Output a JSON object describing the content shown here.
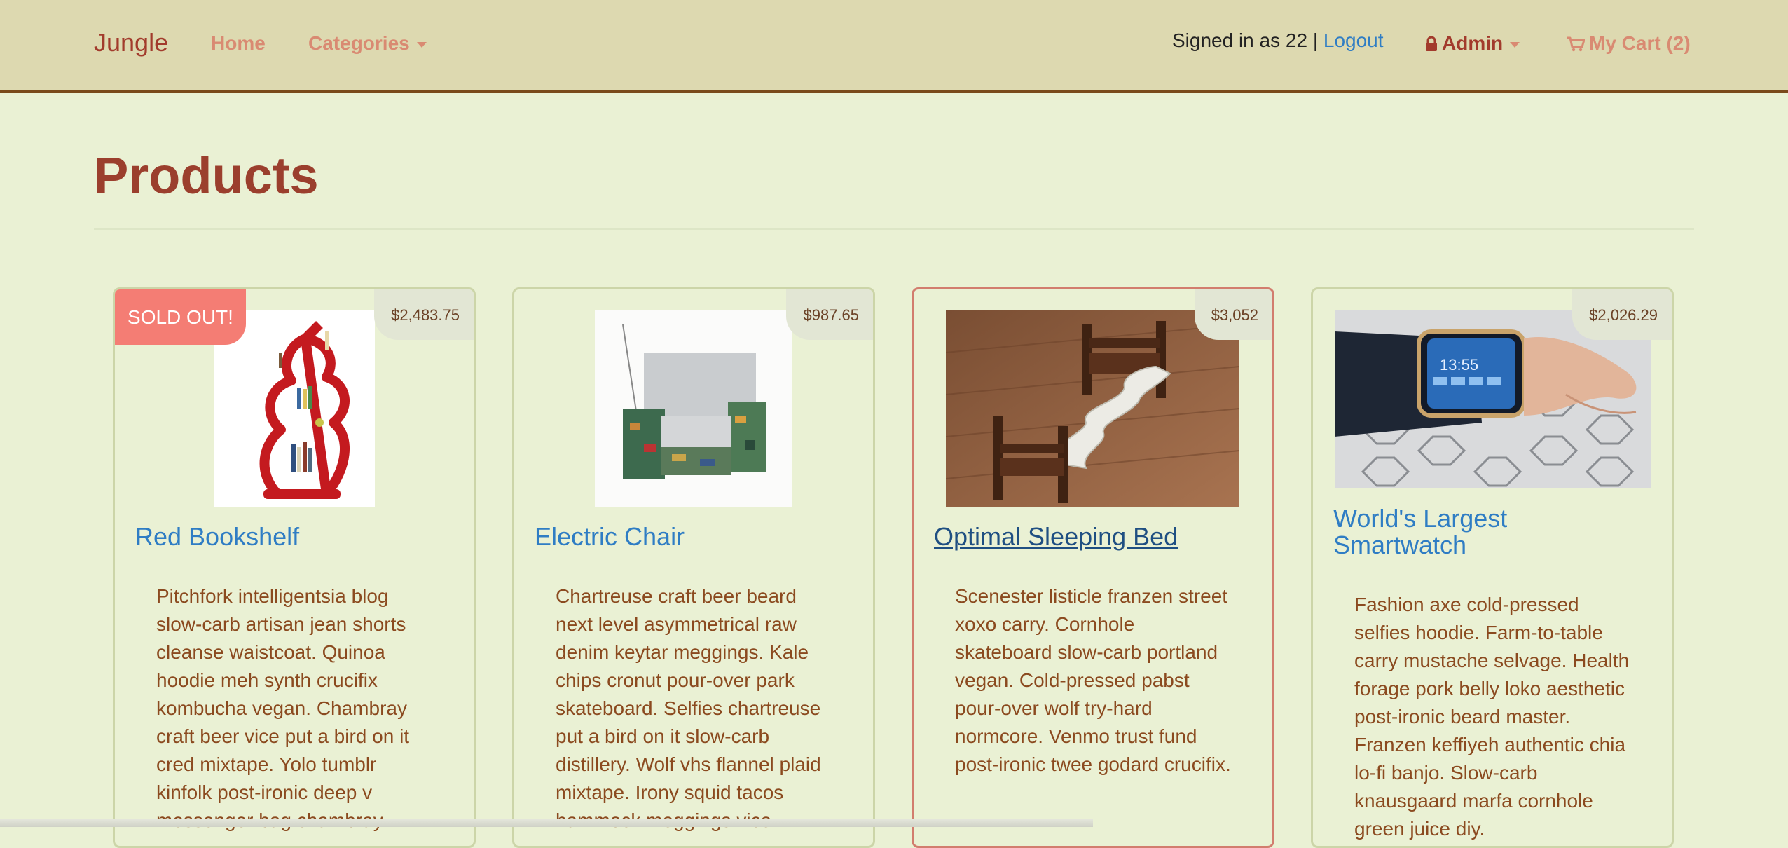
{
  "navbar": {
    "brand": "Jungle",
    "home_label": "Home",
    "categories_label": "Categories",
    "signed_in_text": "Signed in as 22",
    "separator": "|",
    "logout_label": "Logout",
    "admin_label": "Admin",
    "cart_label": "My Cart (2)"
  },
  "page": {
    "title": "Products"
  },
  "products": [
    {
      "name": "Red Bookshelf",
      "price": "$2,483.75",
      "sold_out_label": "SOLD OUT!",
      "description": "Pitchfork intelligentsia blog slow-carb artisan jean shorts cleanse waistcoat. Quinoa hoodie meh synth crucifix kombucha vegan. Chambray craft beer vice put a bird on it cred mixtape. Yolo tumblr kinfolk post-ironic deep v messenger bag chambray."
    },
    {
      "name": "Electric Chair",
      "price": "$987.65",
      "description": "Chartreuse craft beer beard next level asymmetrical raw denim keytar meggings. Kale chips cronut pour-over park skateboard. Selfies chartreuse put a bird on it slow-carb distillery. Wolf vhs flannel plaid mixtape. Irony squid tacos hammock meggings vice."
    },
    {
      "name": "Optimal Sleeping Bed",
      "price": "$3,052",
      "description": "Scenester listicle franzen street xoxo carry. Cornhole skateboard slow-carb portland vegan. Cold-pressed pabst pour-over wolf try-hard normcore. Venmo trust fund post-ironic twee godard crucifix."
    },
    {
      "name": "World's Largest Smartwatch",
      "price": "$2,026.29",
      "description": "Fashion axe cold-pressed selfies hoodie. Farm-to-table carry mustache selvage. Health forage pork belly loko aesthetic post-ironic beard master. Franzen keffiyeh authentic chia lo-fi banjo. Slow-carb knausgaard marfa cornhole green juice diy."
    }
  ],
  "colors": {
    "navbar_bg": "#ddd9b0",
    "page_bg": "#eaf1d4",
    "brand": "#a23b2c",
    "link_blue": "#2f7dc4",
    "sold_out": "#f47d74"
  },
  "icons": {
    "admin": "lock-icon",
    "cart": "cart-icon"
  }
}
